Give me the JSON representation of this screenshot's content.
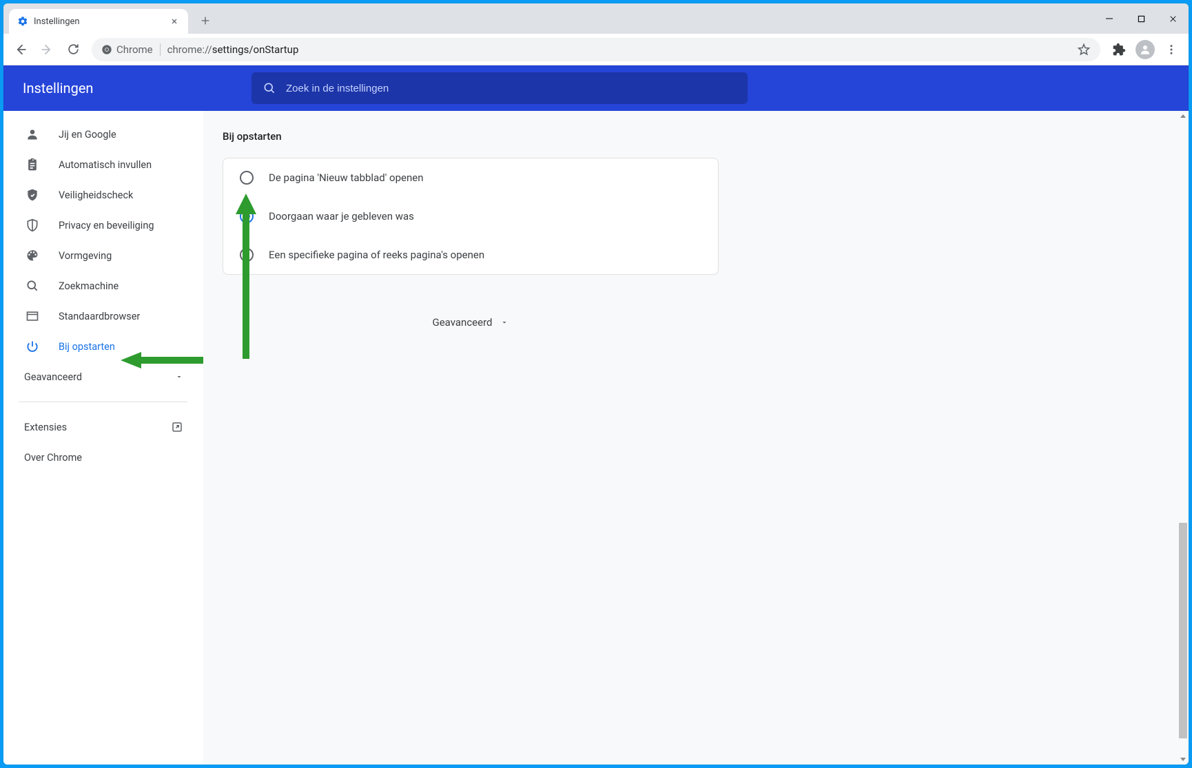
{
  "tab": {
    "title": "Instellingen"
  },
  "omnibox": {
    "chip": "Chrome",
    "url_prefix": "chrome://",
    "url_path": "settings/onStartup"
  },
  "header": {
    "title": "Instellingen",
    "search_placeholder": "Zoek in de instellingen"
  },
  "sidebar": {
    "items": [
      {
        "id": "you-google",
        "label": "Jij en Google"
      },
      {
        "id": "autofill",
        "label": "Automatisch invullen"
      },
      {
        "id": "safety",
        "label": "Veiligheidscheck"
      },
      {
        "id": "privacy",
        "label": "Privacy en beveiliging"
      },
      {
        "id": "appearance",
        "label": "Vormgeving"
      },
      {
        "id": "search",
        "label": "Zoekmachine"
      },
      {
        "id": "default",
        "label": "Standaardbrowser"
      },
      {
        "id": "onstartup",
        "label": "Bij opstarten"
      }
    ],
    "advanced_label": "Geavanceerd",
    "extensions_label": "Extensies",
    "about_label": "Over Chrome"
  },
  "main": {
    "section_title": "Bij opstarten",
    "options": [
      {
        "label": "De pagina 'Nieuw tabblad' openen",
        "selected": false
      },
      {
        "label": "Doorgaan waar je gebleven was",
        "selected": true
      },
      {
        "label": "Een specifieke pagina of reeks pagina's openen",
        "selected": false
      }
    ],
    "advanced_label": "Geavanceerd"
  },
  "colors": {
    "accent": "#1a73e8",
    "header_blue": "#2544d8",
    "annotation_green": "#2e9b2e"
  }
}
